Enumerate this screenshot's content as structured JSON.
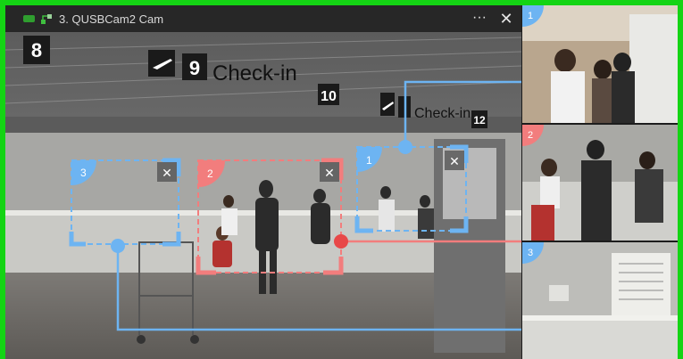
{
  "window": {
    "title": "3. QUSBCam2 Cam",
    "more_label": "···",
    "close_label": "✕"
  },
  "scene_signs": {
    "gate_number": "8",
    "sign_a_number": "9",
    "sign_a_text": "Check-in",
    "sign_a_next": "10",
    "sign_b_text": "Check-in",
    "sign_b_next": "12"
  },
  "regions": [
    {
      "id": "1",
      "color": "#6db4f2",
      "close": "✕"
    },
    {
      "id": "2",
      "color": "#f27d7d",
      "close": "✕"
    },
    {
      "id": "3",
      "color": "#6db4f2",
      "close": "✕"
    }
  ],
  "previews": [
    {
      "label": "1"
    },
    {
      "label": "2"
    },
    {
      "label": "3"
    }
  ],
  "icons": [
    "record-icon",
    "network-icon",
    "more-icon",
    "close-icon",
    "airplane-icon"
  ],
  "colors": {
    "blue": "#6db4f2",
    "red": "#f27d7d",
    "frame": "#14d414"
  }
}
